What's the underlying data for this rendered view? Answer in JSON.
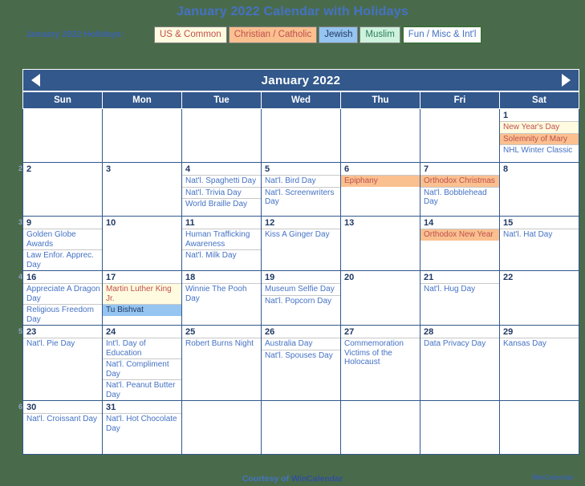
{
  "header": {
    "title": "January 2022 Calendar with Holidays",
    "legend_label": "January 2022 Holidays:",
    "legend": [
      {
        "name": "US & Common",
        "color": "#fffbe0",
        "text_color": "#c0504d"
      },
      {
        "name": "Christian / Catholic",
        "color": "#fac090",
        "text_color": "#c0504d"
      },
      {
        "name": "Jewish",
        "color": "#95c5f0",
        "text_color": "#1f3864"
      },
      {
        "name": "Muslim",
        "color": "#cdf2dd",
        "text_color": "#2e7d5b"
      },
      {
        "name": "Fun / Misc & Int'l",
        "color": "#ffffff",
        "text_color": "#4472c4"
      }
    ]
  },
  "calendar": {
    "month_title": "January 2022",
    "prev_label": "Previous month",
    "next_label": "Next month",
    "weekday_headers": [
      "Sun",
      "Mon",
      "Tue",
      "Wed",
      "Thu",
      "Fri",
      "Sat"
    ],
    "week_numbers": [
      "2",
      "3",
      "4",
      "5",
      "6"
    ],
    "weeks": [
      [
        {
          "day": "",
          "empty": true,
          "events": []
        },
        {
          "day": "",
          "empty": true,
          "events": []
        },
        {
          "day": "",
          "empty": true,
          "events": []
        },
        {
          "day": "",
          "empty": true,
          "events": []
        },
        {
          "day": "",
          "empty": true,
          "events": []
        },
        {
          "day": "",
          "empty": true,
          "events": []
        },
        {
          "day": "1",
          "weekend": true,
          "events": [
            {
              "text": "New Year's Day",
              "type": "us"
            },
            {
              "text": "Solemnity of Mary",
              "type": "chr"
            },
            {
              "text": "NHL Winter Classic",
              "type": "fun"
            }
          ]
        }
      ],
      [
        {
          "day": "2",
          "weekend": true,
          "events": []
        },
        {
          "day": "3",
          "events": []
        },
        {
          "day": "4",
          "events": [
            {
              "text": "Nat'l. Spaghetti Day",
              "type": "fun"
            },
            {
              "text": "Nat'l. Trivia Day",
              "type": "fun"
            },
            {
              "text": "World Braille Day",
              "type": "fun"
            }
          ]
        },
        {
          "day": "5",
          "events": [
            {
              "text": "Nat'l. Bird Day",
              "type": "fun"
            },
            {
              "text": "Nat'l. Screenwriters Day",
              "type": "fun"
            }
          ]
        },
        {
          "day": "6",
          "events": [
            {
              "text": "Epiphany",
              "type": "chr"
            }
          ]
        },
        {
          "day": "7",
          "events": [
            {
              "text": "Orthodox Christmas",
              "type": "chr"
            },
            {
              "text": "Nat'l. Bobblehead Day",
              "type": "fun"
            }
          ]
        },
        {
          "day": "8",
          "weekend": true,
          "events": []
        }
      ],
      [
        {
          "day": "9",
          "weekend": true,
          "events": [
            {
              "text": "Golden Globe Awards",
              "type": "fun"
            },
            {
              "text": "Law Enfor. Apprec. Day",
              "type": "fun"
            }
          ]
        },
        {
          "day": "10",
          "events": []
        },
        {
          "day": "11",
          "events": [
            {
              "text": "Human Trafficking Awareness",
              "type": "fun"
            },
            {
              "text": "Nat'l. Milk Day",
              "type": "fun"
            }
          ]
        },
        {
          "day": "12",
          "events": [
            {
              "text": "Kiss A Ginger Day",
              "type": "fun"
            }
          ]
        },
        {
          "day": "13",
          "events": []
        },
        {
          "day": "14",
          "events": [
            {
              "text": "Orthodox New Year",
              "type": "chr"
            }
          ]
        },
        {
          "day": "15",
          "weekend": true,
          "events": [
            {
              "text": "Nat'l. Hat Day",
              "type": "fun"
            }
          ]
        }
      ],
      [
        {
          "day": "16",
          "weekend": true,
          "events": [
            {
              "text": "Appreciate A Dragon Day",
              "type": "fun"
            },
            {
              "text": "Religious Freedom Day",
              "type": "fun"
            }
          ]
        },
        {
          "day": "17",
          "events": [
            {
              "text": "Martin Luther King Jr.",
              "type": "us"
            },
            {
              "text": "Tu Bishvat",
              "type": "jew"
            }
          ]
        },
        {
          "day": "18",
          "events": [
            {
              "text": "Winnie The Pooh Day",
              "type": "fun"
            }
          ]
        },
        {
          "day": "19",
          "events": [
            {
              "text": "Museum Selfie Day",
              "type": "fun"
            },
            {
              "text": "Nat'l. Popcorn Day",
              "type": "fun"
            }
          ]
        },
        {
          "day": "20",
          "events": []
        },
        {
          "day": "21",
          "events": [
            {
              "text": "Nat'l. Hug Day",
              "type": "fun"
            }
          ]
        },
        {
          "day": "22",
          "weekend": true,
          "events": []
        }
      ],
      [
        {
          "day": "23",
          "weekend": true,
          "events": [
            {
              "text": "Nat'l. Pie Day",
              "type": "fun"
            }
          ]
        },
        {
          "day": "24",
          "events": [
            {
              "text": "Int'l. Day of Education",
              "type": "fun"
            },
            {
              "text": "Nat'l. Compliment Day",
              "type": "fun"
            },
            {
              "text": "Nat'l. Peanut Butter Day",
              "type": "fun"
            }
          ]
        },
        {
          "day": "25",
          "events": [
            {
              "text": "Robert Burns Night",
              "type": "fun"
            }
          ]
        },
        {
          "day": "26",
          "events": [
            {
              "text": "Australia Day",
              "type": "fun"
            },
            {
              "text": "Nat'l. Spouses Day",
              "type": "fun"
            }
          ]
        },
        {
          "day": "27",
          "events": [
            {
              "text": "Commemoration Victims of the Holocaust",
              "type": "fun"
            }
          ]
        },
        {
          "day": "28",
          "events": [
            {
              "text": "Data Privacy Day",
              "type": "fun"
            }
          ]
        },
        {
          "day": "29",
          "weekend": true,
          "events": [
            {
              "text": "Kansas Day",
              "type": "fun"
            }
          ]
        }
      ],
      [
        {
          "day": "30",
          "weekend": true,
          "events": [
            {
              "text": "Nat'l. Croissant Day",
              "type": "fun"
            }
          ]
        },
        {
          "day": "31",
          "events": [
            {
              "text": "Nat'l. Hot Chocolate Day",
              "type": "fun"
            }
          ]
        },
        {
          "day": "",
          "empty": true,
          "events": []
        },
        {
          "day": "",
          "empty": true,
          "events": []
        },
        {
          "day": "",
          "empty": true,
          "events": []
        },
        {
          "day": "",
          "empty": true,
          "events": []
        },
        {
          "day": "",
          "empty": true,
          "events": []
        }
      ]
    ]
  },
  "footer": {
    "brand": "WinCalendar",
    "courtesy_prefix": "Courtesy of ",
    "courtesy_brand": "WinCalendar"
  }
}
